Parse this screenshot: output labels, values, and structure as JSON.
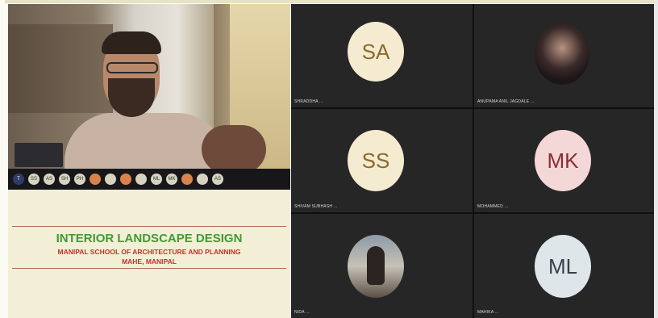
{
  "presenter": {
    "participant_chips": [
      "T",
      "SS",
      "AS",
      "SH",
      "PH",
      "",
      "",
      "",
      "",
      "ML",
      "MK",
      "",
      "",
      "AS"
    ]
  },
  "slide": {
    "title": "INTERIOR LANDSCAPE DESIGN",
    "line1": "MANIPAL SCHOOL OF ARCHITECTURE AND PLANNING",
    "line2": "MAHE, MANIPAL",
    "title_color": "#3f9b33",
    "subtitle_color": "#c0332a"
  },
  "gallery": {
    "tiles": [
      {
        "initials": "SA",
        "name": "SHRADDHA ...",
        "avatar_bg": "#f5ebd0",
        "avatar_fg": "#8b6a2f"
      },
      {
        "initials": "",
        "name": "ANUPAMA ANIL JAGDALE ...",
        "avatar_bg": "",
        "avatar_fg": ""
      },
      {
        "initials": "SS",
        "name": "SHIVAM SUBHASH ...",
        "avatar_bg": "#f5ebd0",
        "avatar_fg": "#8b6a2f"
      },
      {
        "initials": "MK",
        "name": "MOHAMMED ...",
        "avatar_bg": "#f4d7d7",
        "avatar_fg": "#8a2e34"
      },
      {
        "initials": "",
        "name": "NIDA ...",
        "avatar_bg": "",
        "avatar_fg": ""
      },
      {
        "initials": "ML",
        "name": "MAHIKA ...",
        "avatar_bg": "#dfe6ea",
        "avatar_fg": "#35414a"
      }
    ]
  }
}
